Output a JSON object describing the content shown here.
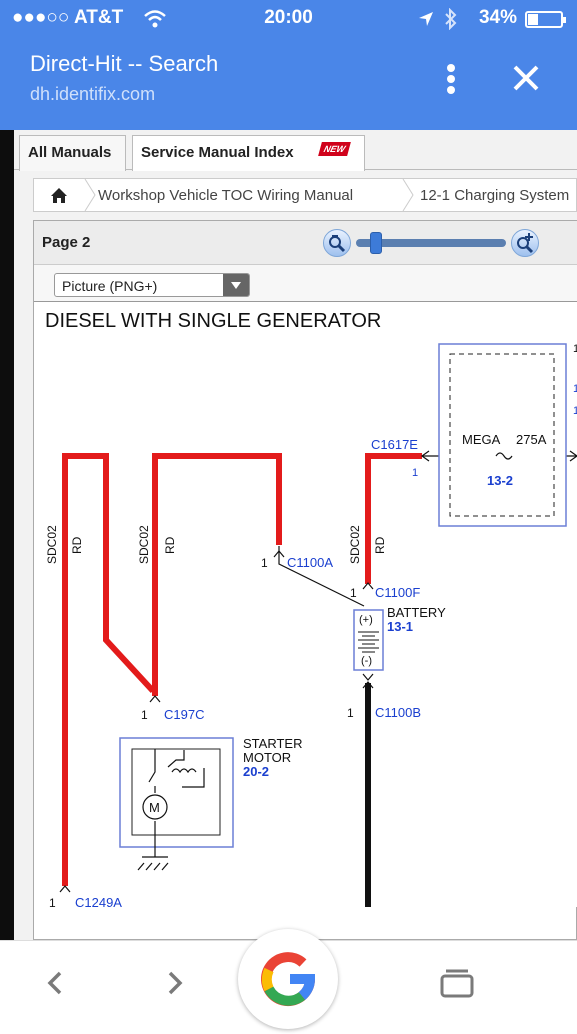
{
  "status_bar": {
    "carrier": "●●●○○ AT&T",
    "time": "20:00",
    "battery": "34%"
  },
  "browser": {
    "title": "Direct-Hit -- Search",
    "url": "dh.identifix.com"
  },
  "tabs": [
    {
      "label": "All Manuals"
    },
    {
      "label": "Service Manual Index"
    }
  ],
  "new_badge": "NEW",
  "breadcrumb": [
    "Workshop Vehicle TOC Wiring Manual",
    "12-1 Charging System"
  ],
  "viewer": {
    "page_label": "Page 2",
    "zoom_level": 0.1,
    "format": "Picture (PNG+)"
  },
  "diagram": {
    "title": "DIESEL WITH SINGLE GENERATOR",
    "wire_circuit": "SDC02",
    "wire_color": "RD",
    "pin": "1",
    "connectors": {
      "c1617e": "C1617E",
      "c1100a": "C1100A",
      "c1100f": "C1100F",
      "c1100b": "C1100B",
      "c197c": "C197C",
      "c1249a": "C1249A"
    },
    "battery_label": "BATTERY",
    "battery_ref": "13-1",
    "battery_plus": "(+)",
    "battery_minus": "(-)",
    "fuse_label": "MEGA",
    "fuse_rating": "275A",
    "fuse_ref": "13-2",
    "starter_label_1": "STARTER",
    "starter_label_2": "MOTOR",
    "starter_ref": "20-2",
    "motor_symbol": "M",
    "edge_text": [
      "1",
      "1",
      "1"
    ],
    "colors": {
      "red_wire": "#e31b1b",
      "black_wire": "#111111",
      "component_border": "#6b7fd6",
      "ref_blue": "#1a3fcf"
    }
  }
}
